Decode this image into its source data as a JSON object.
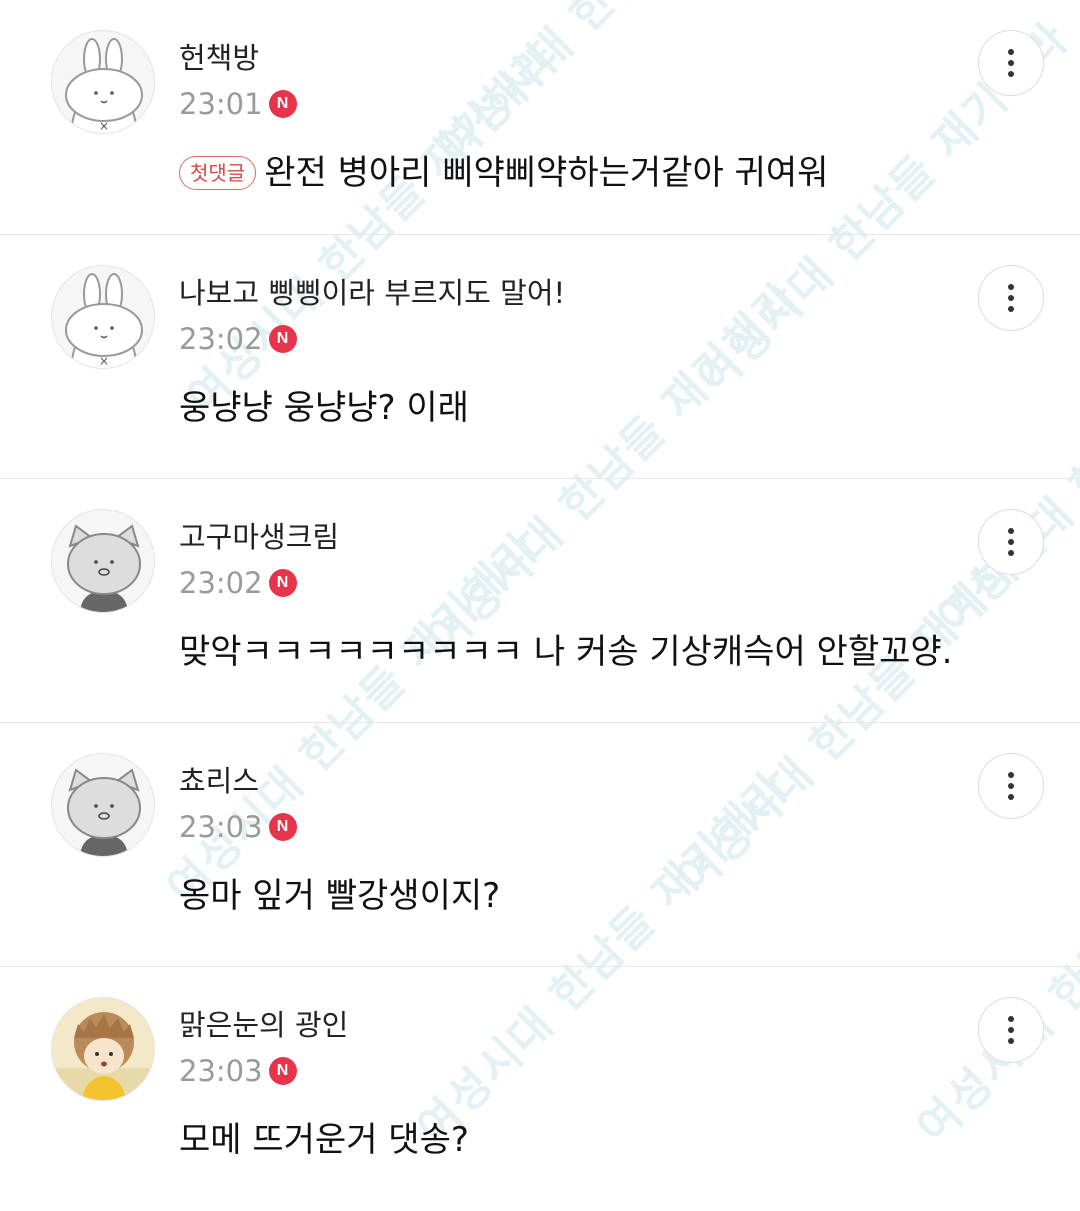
{
  "watermark": {
    "line1": "여성시대",
    "line2": "한남들 재기해라"
  },
  "first_comment_tag": "첫댓글",
  "new_badge": "N",
  "comments": [
    {
      "nickname": "헌책방",
      "time": "23:01",
      "text": "완전 병아리 삐약삐약하는거같아 귀여워",
      "avatar": "rabbit-avatar",
      "first": true
    },
    {
      "nickname": "나보고 삥삥이라 부르지도 말어!",
      "time": "23:02",
      "text": "웅냥냥 웅냥냥? 이래",
      "avatar": "rabbit-avatar",
      "first": false
    },
    {
      "nickname": "고구마생크림",
      "time": "23:02",
      "text": "맞악ㅋㅋㅋㅋㅋㅋㅋㅋㅋ 나 커송 기상캐슥어 안할꼬양.",
      "avatar": "cat-avatar",
      "first": false
    },
    {
      "nickname": "쵸리스",
      "time": "23:03",
      "text": "옹마 잎거 빨강생이지?",
      "avatar": "cat-avatar",
      "first": false
    },
    {
      "nickname": "맑은눈의 광인",
      "time": "23:03",
      "text": "모메 뜨거운거 댓송?",
      "avatar": "photo-avatar",
      "first": false
    }
  ],
  "colors": {
    "badge": "#e8344a",
    "first_tag": "#d94848",
    "watermark": "#e3f0f4"
  }
}
